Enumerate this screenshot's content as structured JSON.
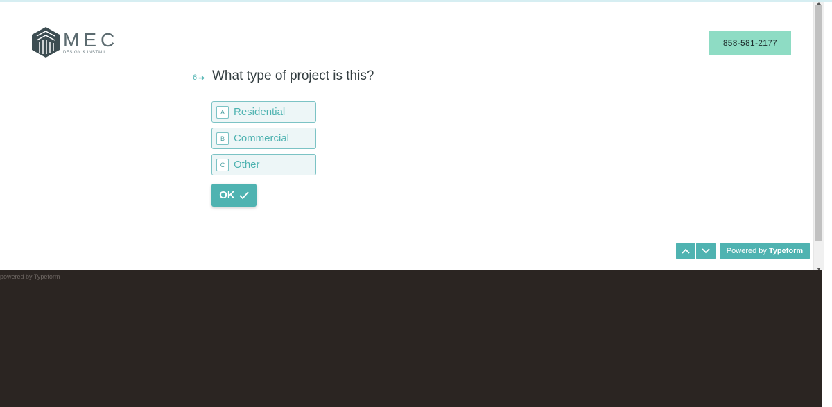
{
  "header": {
    "logo": {
      "title": "MEC",
      "subtitle": "DESIGN & INSTALL",
      "icon": "hexagon-stripes-logo"
    },
    "phone_label": "858-581-2177"
  },
  "question": {
    "number": "6",
    "arrow_icon": "arrow-right-icon",
    "text": "What type of project is this?"
  },
  "choices": [
    {
      "key": "A",
      "label": "Residential"
    },
    {
      "key": "B",
      "label": "Commercial"
    },
    {
      "key": "C",
      "label": "Other"
    }
  ],
  "ok_button": {
    "label": "OK",
    "icon": "check-icon"
  },
  "navigation": {
    "up_icon": "chevron-up-icon",
    "down_icon": "chevron-down-icon"
  },
  "powered": {
    "prefix": "Powered by",
    "brand": "Typeform"
  },
  "footer": {
    "text": "powered by Typeform"
  },
  "colors": {
    "accent": "#4fb3b1",
    "phone_bg": "#8edcc4",
    "footer_bg": "#2b2522"
  }
}
